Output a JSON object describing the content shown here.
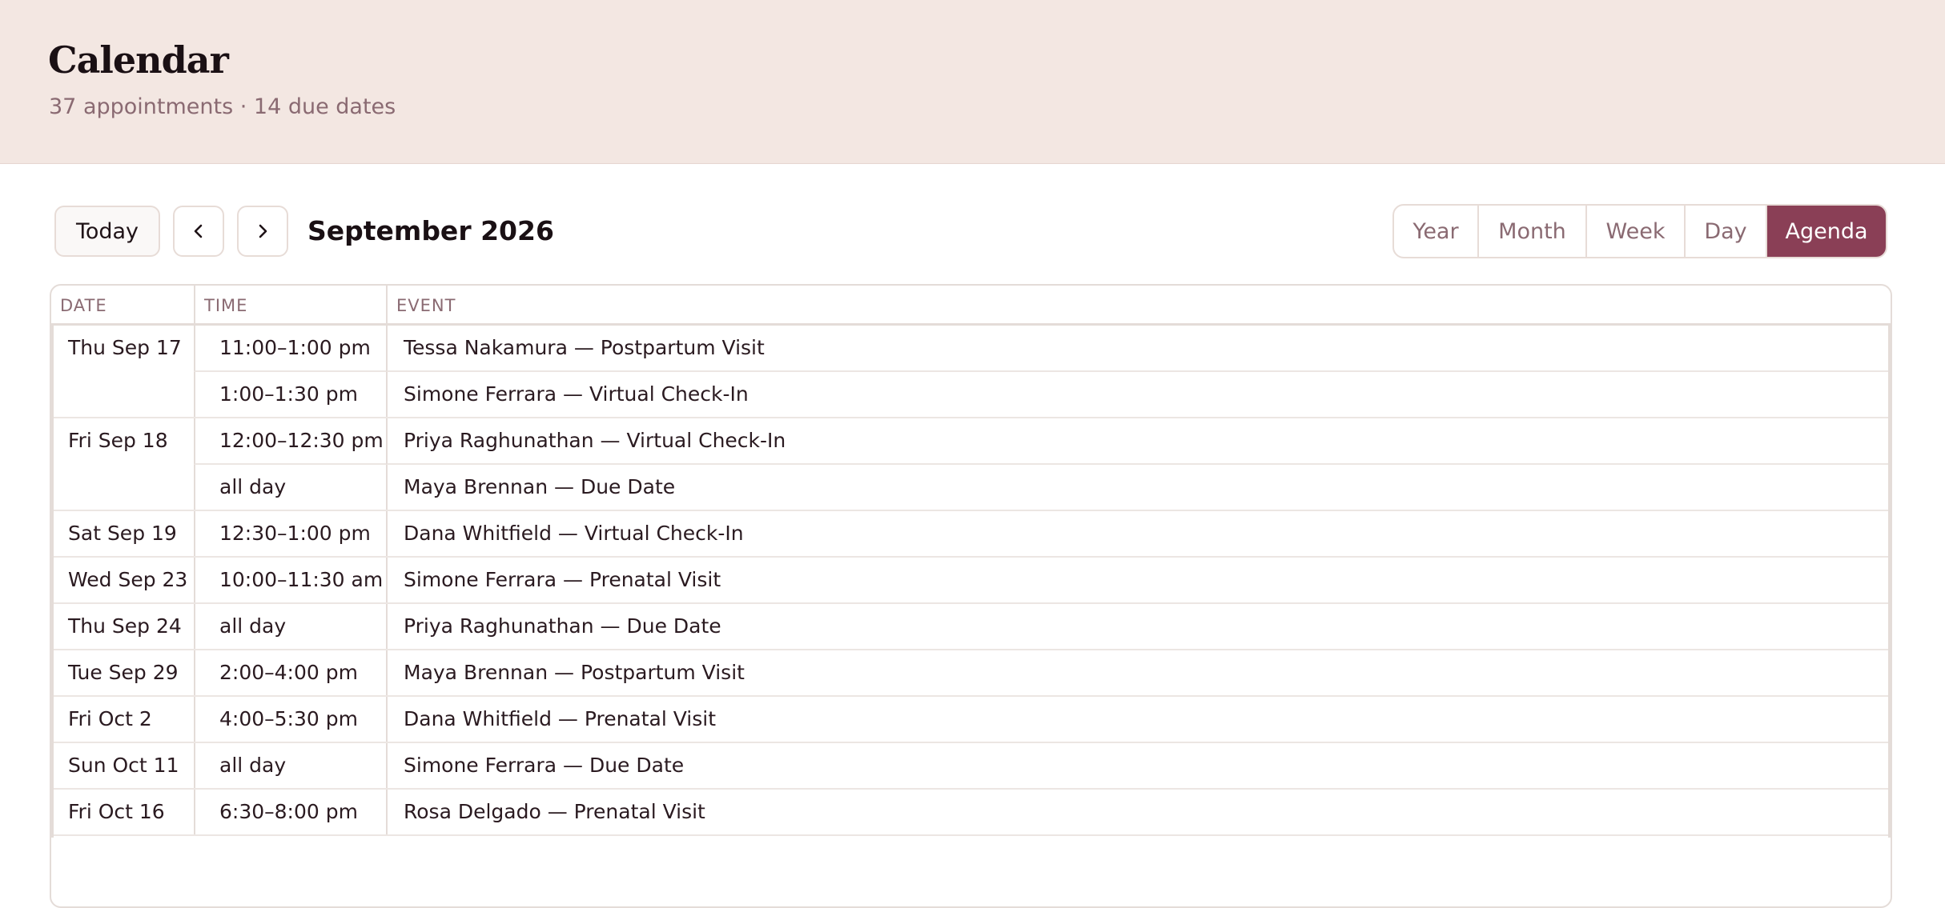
{
  "header": {
    "title": "Calendar",
    "subtitle": "37 appointments · 14 due dates"
  },
  "toolbar": {
    "today_label": "Today",
    "prev_icon": "chevron-left-icon",
    "next_icon": "chevron-right-icon",
    "period_label": "September 2026",
    "views": [
      {
        "label": "Year",
        "active": false
      },
      {
        "label": "Month",
        "active": false
      },
      {
        "label": "Week",
        "active": false
      },
      {
        "label": "Day",
        "active": false
      },
      {
        "label": "Agenda",
        "active": true
      }
    ]
  },
  "agenda": {
    "columns": [
      "DATE",
      "TIME",
      "EVENT"
    ],
    "rows": [
      {
        "date": "Thu Sep 17",
        "time": "11:00–1:00 pm",
        "event": "Tessa Nakamura — Postpartum Visit"
      },
      {
        "date": "",
        "time": "1:00–1:30 pm",
        "event": "Simone Ferrara — Virtual Check-In"
      },
      {
        "date": "Fri Sep 18",
        "time": "12:00–12:30 pm",
        "event": "Priya Raghunathan — Virtual Check-In"
      },
      {
        "date": "",
        "time": "all day",
        "event": "Maya Brennan — Due Date"
      },
      {
        "date": "Sat Sep 19",
        "time": "12:30–1:00 pm",
        "event": "Dana Whitfield — Virtual Check-In"
      },
      {
        "date": "Wed Sep 23",
        "time": "10:00–11:30 am",
        "event": "Simone Ferrara — Prenatal Visit"
      },
      {
        "date": "Thu Sep 24",
        "time": "all day",
        "event": "Priya Raghunathan — Due Date"
      },
      {
        "date": "Tue Sep 29",
        "time": "2:00–4:00 pm",
        "event": "Maya Brennan — Postpartum Visit"
      },
      {
        "date": "Fri Oct 2",
        "time": "4:00–5:30 pm",
        "event": "Dana Whitfield — Prenatal Visit"
      },
      {
        "date": "Sun Oct 11",
        "time": "all day",
        "event": "Simone Ferrara — Due Date"
      },
      {
        "date": "Fri Oct 16",
        "time": "6:30–8:00 pm",
        "event": "Rosa Delgado — Prenatal Visit"
      }
    ]
  },
  "colors": {
    "header_bg": "#f3e7e2",
    "accent": "#8a3f56",
    "muted_text": "#8a6a72",
    "border": "#e4dcd8"
  }
}
